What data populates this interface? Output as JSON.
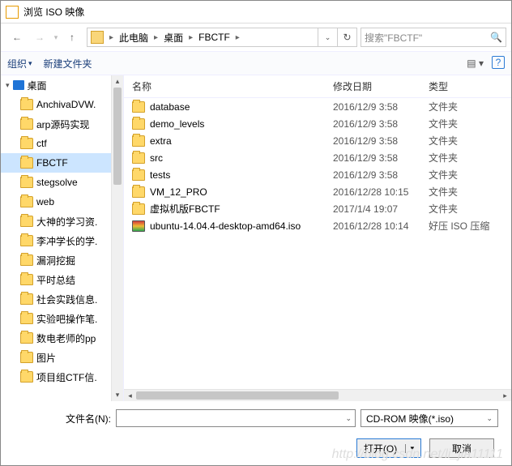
{
  "title": "浏览 ISO 映像",
  "nav": {
    "back": "←",
    "fwd": "→",
    "up": "↑",
    "refresh": "↻"
  },
  "breadcrumb": {
    "items": [
      "此电脑",
      "桌面",
      "FBCTF"
    ]
  },
  "search": {
    "placeholder": "搜索\"FBCTF\""
  },
  "toolbar": {
    "organize": "组织",
    "newfolder": "新建文件夹"
  },
  "tree": {
    "desktop": "桌面",
    "items": [
      {
        "label": "AnchivaDVW."
      },
      {
        "label": "arp源码实现"
      },
      {
        "label": "ctf"
      },
      {
        "label": "FBCTF",
        "sel": true
      },
      {
        "label": "stegsolve"
      },
      {
        "label": "web"
      },
      {
        "label": "大神的学习资."
      },
      {
        "label": "李冲学长的学."
      },
      {
        "label": "漏洞挖掘"
      },
      {
        "label": "平时总结"
      },
      {
        "label": "社会实践信息."
      },
      {
        "label": "实验吧操作笔."
      },
      {
        "label": "数电老师的pp"
      },
      {
        "label": "图片"
      },
      {
        "label": "项目组CTF信."
      }
    ]
  },
  "headers": {
    "name": "名称",
    "date": "修改日期",
    "type": "类型"
  },
  "files": [
    {
      "icon": "folder",
      "name": "database",
      "date": "2016/12/9 3:58",
      "type": "文件夹"
    },
    {
      "icon": "folder",
      "name": "demo_levels",
      "date": "2016/12/9 3:58",
      "type": "文件夹"
    },
    {
      "icon": "folder",
      "name": "extra",
      "date": "2016/12/9 3:58",
      "type": "文件夹"
    },
    {
      "icon": "folder",
      "name": "src",
      "date": "2016/12/9 3:58",
      "type": "文件夹"
    },
    {
      "icon": "folder",
      "name": "tests",
      "date": "2016/12/9 3:58",
      "type": "文件夹"
    },
    {
      "icon": "folder",
      "name": "VM_12_PRO",
      "date": "2016/12/28 10:15",
      "type": "文件夹"
    },
    {
      "icon": "folder",
      "name": "虚拟机版FBCTF",
      "date": "2017/1/4 19:07",
      "type": "文件夹"
    },
    {
      "icon": "iso",
      "name": "ubuntu-14.04.4-desktop-amd64.iso",
      "date": "2016/12/28 10:14",
      "type": "好压 ISO 压缩"
    }
  ],
  "footer": {
    "filename_label": "文件名(N):",
    "filename_value": "",
    "filter": "CD-ROM 映像(*.iso)",
    "open": "打开(O)",
    "cancel": "取消"
  },
  "watermark": "http://blog.csdn.net/li_jia11111"
}
